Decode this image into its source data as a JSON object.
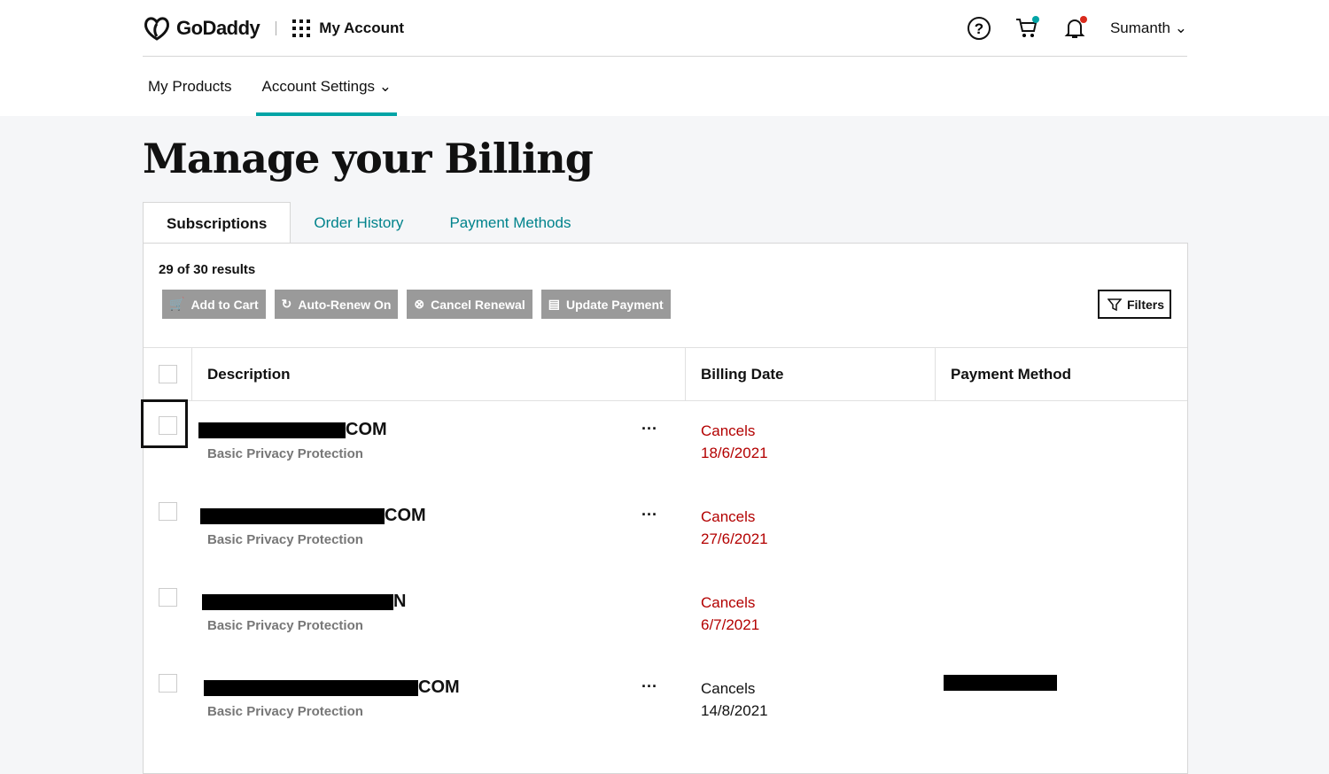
{
  "header": {
    "brand": "GoDaddy",
    "app": "My Account",
    "user": "Sumanth",
    "cart_dot": "#00a4a6",
    "bell_dot": "#d92a1c"
  },
  "nav": [
    {
      "label": "My Products"
    },
    {
      "label": "Account Settings"
    }
  ],
  "page_title": "Manage your Billing",
  "tabs": [
    {
      "label": "Subscriptions"
    },
    {
      "label": "Order History"
    },
    {
      "label": "Payment Methods"
    }
  ],
  "results": "29 of 30 results",
  "actions": {
    "add_to_cart": "Add to Cart",
    "auto_renew": "Auto-Renew On",
    "cancel_renewal": "Cancel Renewal",
    "update_payment": "Update Payment",
    "filters": "Filters"
  },
  "columns": {
    "description": "Description",
    "billing_date": "Billing Date",
    "payment_method": "Payment Method"
  },
  "rows": [
    {
      "name_suffix": "COM",
      "product": "Basic Privacy Protection",
      "status": "Cancels",
      "date": "18/6/2021",
      "red": true
    },
    {
      "name_suffix": "COM",
      "product": "Basic Privacy Protection",
      "status": "Cancels",
      "date": "27/6/2021",
      "red": true
    },
    {
      "name_suffix": "N",
      "product": "Basic Privacy Protection",
      "status": "Cancels",
      "date": "6/7/2021",
      "red": true
    },
    {
      "name_suffix": "COM",
      "product": "Basic Privacy Protection",
      "status": "Cancels",
      "date": "14/8/2021",
      "red": false
    }
  ]
}
